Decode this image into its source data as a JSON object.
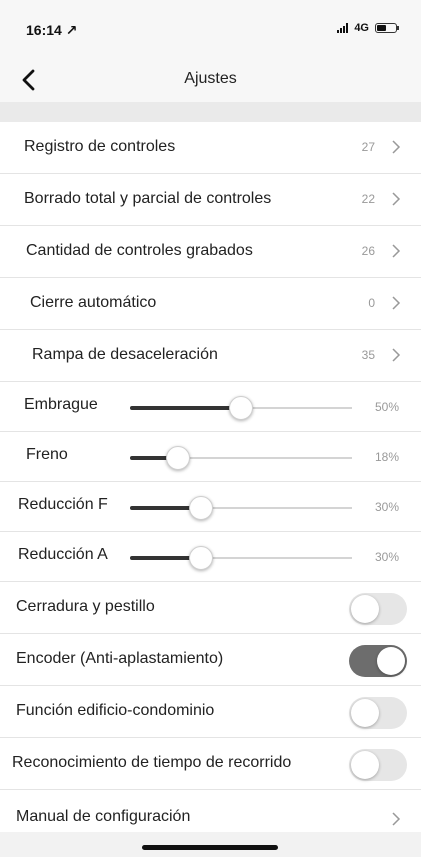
{
  "status": {
    "time": "16:14 ↗",
    "network": "4G"
  },
  "nav": {
    "title": "Ajustes"
  },
  "menu": [
    {
      "label": "Registro de controles",
      "value": "27"
    },
    {
      "label": "Borrado total y parcial de controles",
      "value": "22"
    },
    {
      "label": "Cantidad de controles grabados",
      "value": "26"
    },
    {
      "label": "Cierre automático",
      "value": "0"
    },
    {
      "label": "Rampa de desaceleración",
      "value": "35"
    }
  ],
  "sliders": [
    {
      "label": "Embrague",
      "value_text": "50%",
      "fraction": 0.5
    },
    {
      "label": "Freno",
      "value_text": "18%",
      "fraction": 0.18
    },
    {
      "label": "Reducción F",
      "value_text": "30%",
      "fraction": 0.3
    },
    {
      "label": "Reducción A",
      "value_text": "30%",
      "fraction": 0.3
    }
  ],
  "toggles": [
    {
      "label": "Cerradura y pestillo",
      "on": false
    },
    {
      "label": "Encoder (Anti-aplastamiento)",
      "on": true
    },
    {
      "label": "Función edificio-condominio",
      "on": false
    },
    {
      "label": "Reconocimiento de tiempo de recorrido",
      "on": false
    }
  ],
  "manual": {
    "label": "Manual de configuración"
  },
  "colors": {
    "toggle_on": "#6d6d6d",
    "toggle_off": "#e6e6e6",
    "slider_fill": "#333333"
  }
}
